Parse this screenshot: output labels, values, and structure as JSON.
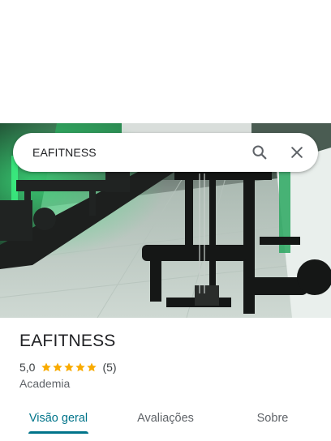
{
  "search": {
    "value": "EAFITNESS",
    "search_icon": "search-icon",
    "close_icon": "close-icon"
  },
  "place": {
    "name": "EAFITNESS",
    "rating": "5,0",
    "stars": 5,
    "review_count": "(5)",
    "category": "Academia"
  },
  "tabs": [
    {
      "label": "Visão geral",
      "active": true
    },
    {
      "label": "Avaliações",
      "active": false
    },
    {
      "label": "Sobre",
      "active": false
    }
  ],
  "colors": {
    "accent": "#00748a",
    "star": "#f9ab00",
    "text": "#202124",
    "muted": "#5f6368"
  }
}
